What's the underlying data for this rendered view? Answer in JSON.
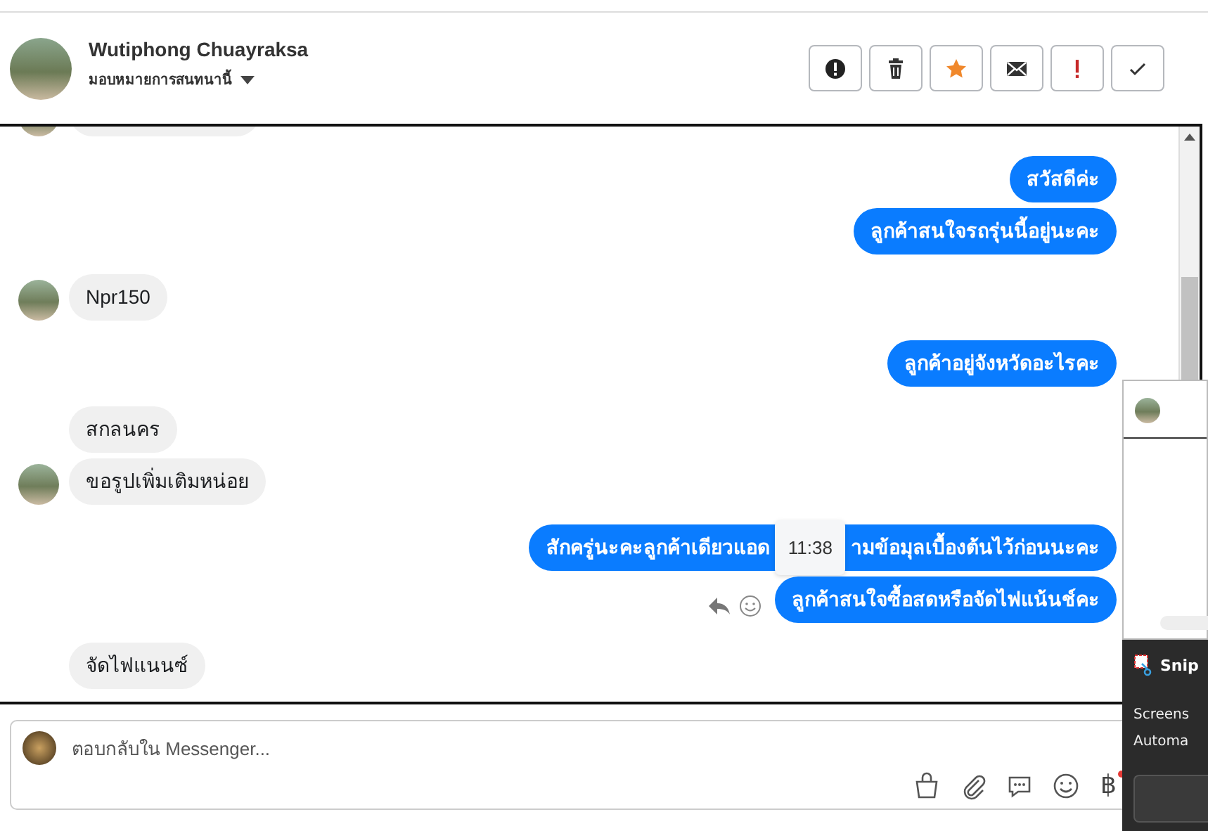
{
  "header": {
    "name": "Wutiphong Chuayraksa",
    "assign_label": "มอบหมายการสนทนานี้"
  },
  "toolbar": [
    {
      "kind": "spam"
    },
    {
      "kind": "delete"
    },
    {
      "kind": "star"
    },
    {
      "kind": "unread"
    },
    {
      "kind": "important"
    },
    {
      "kind": "done"
    }
  ],
  "messages": [
    {
      "outgoing": false,
      "kind": "stub",
      "avatar": true,
      "actions": false
    },
    {
      "outgoing": true,
      "kind": "text",
      "text": "สวัสดีค่ะ",
      "actions": false
    },
    {
      "outgoing": true,
      "kind": "text",
      "text": "ลูกค้าสนใจรถรุ่นนี้อยู่นะคะ",
      "actions": false
    },
    {
      "outgoing": false,
      "kind": "text",
      "text": "Npr150",
      "avatar": true,
      "actions": false
    },
    {
      "outgoing": true,
      "kind": "text",
      "text": "ลูกค้าอยู่จังหวัดอะไรคะ",
      "actions": false
    },
    {
      "outgoing": false,
      "kind": "text",
      "text": "สกลนคร",
      "avatar": false,
      "actions": false
    },
    {
      "outgoing": false,
      "kind": "text",
      "text": "ขอรูปเพิ่มเติมหน่อย",
      "avatar": true,
      "actions": false
    },
    {
      "outgoing": true,
      "kind": "split",
      "text": "สักครู่นะคะลูกค้าเดียวแอด",
      "time": "11:38",
      "text_after": "ามข้อมุลเบื้องต้นไว้ก่อนนะคะ",
      "actions": false
    },
    {
      "outgoing": true,
      "kind": "text",
      "text": "ลูกค้าสนใจซื้อสดหรือจัดไฟแน้นช์คะ",
      "actions": true
    },
    {
      "outgoing": false,
      "kind": "text",
      "text": "จัดไฟแนนซ์",
      "avatar": false,
      "actions": false
    }
  ],
  "composer": {
    "placeholder": "ตอบกลับใน Messenger...",
    "currency_symbol": "฿"
  },
  "notification": {
    "app": "Snip",
    "line_1": "Screens",
    "line_2": "Automa"
  }
}
